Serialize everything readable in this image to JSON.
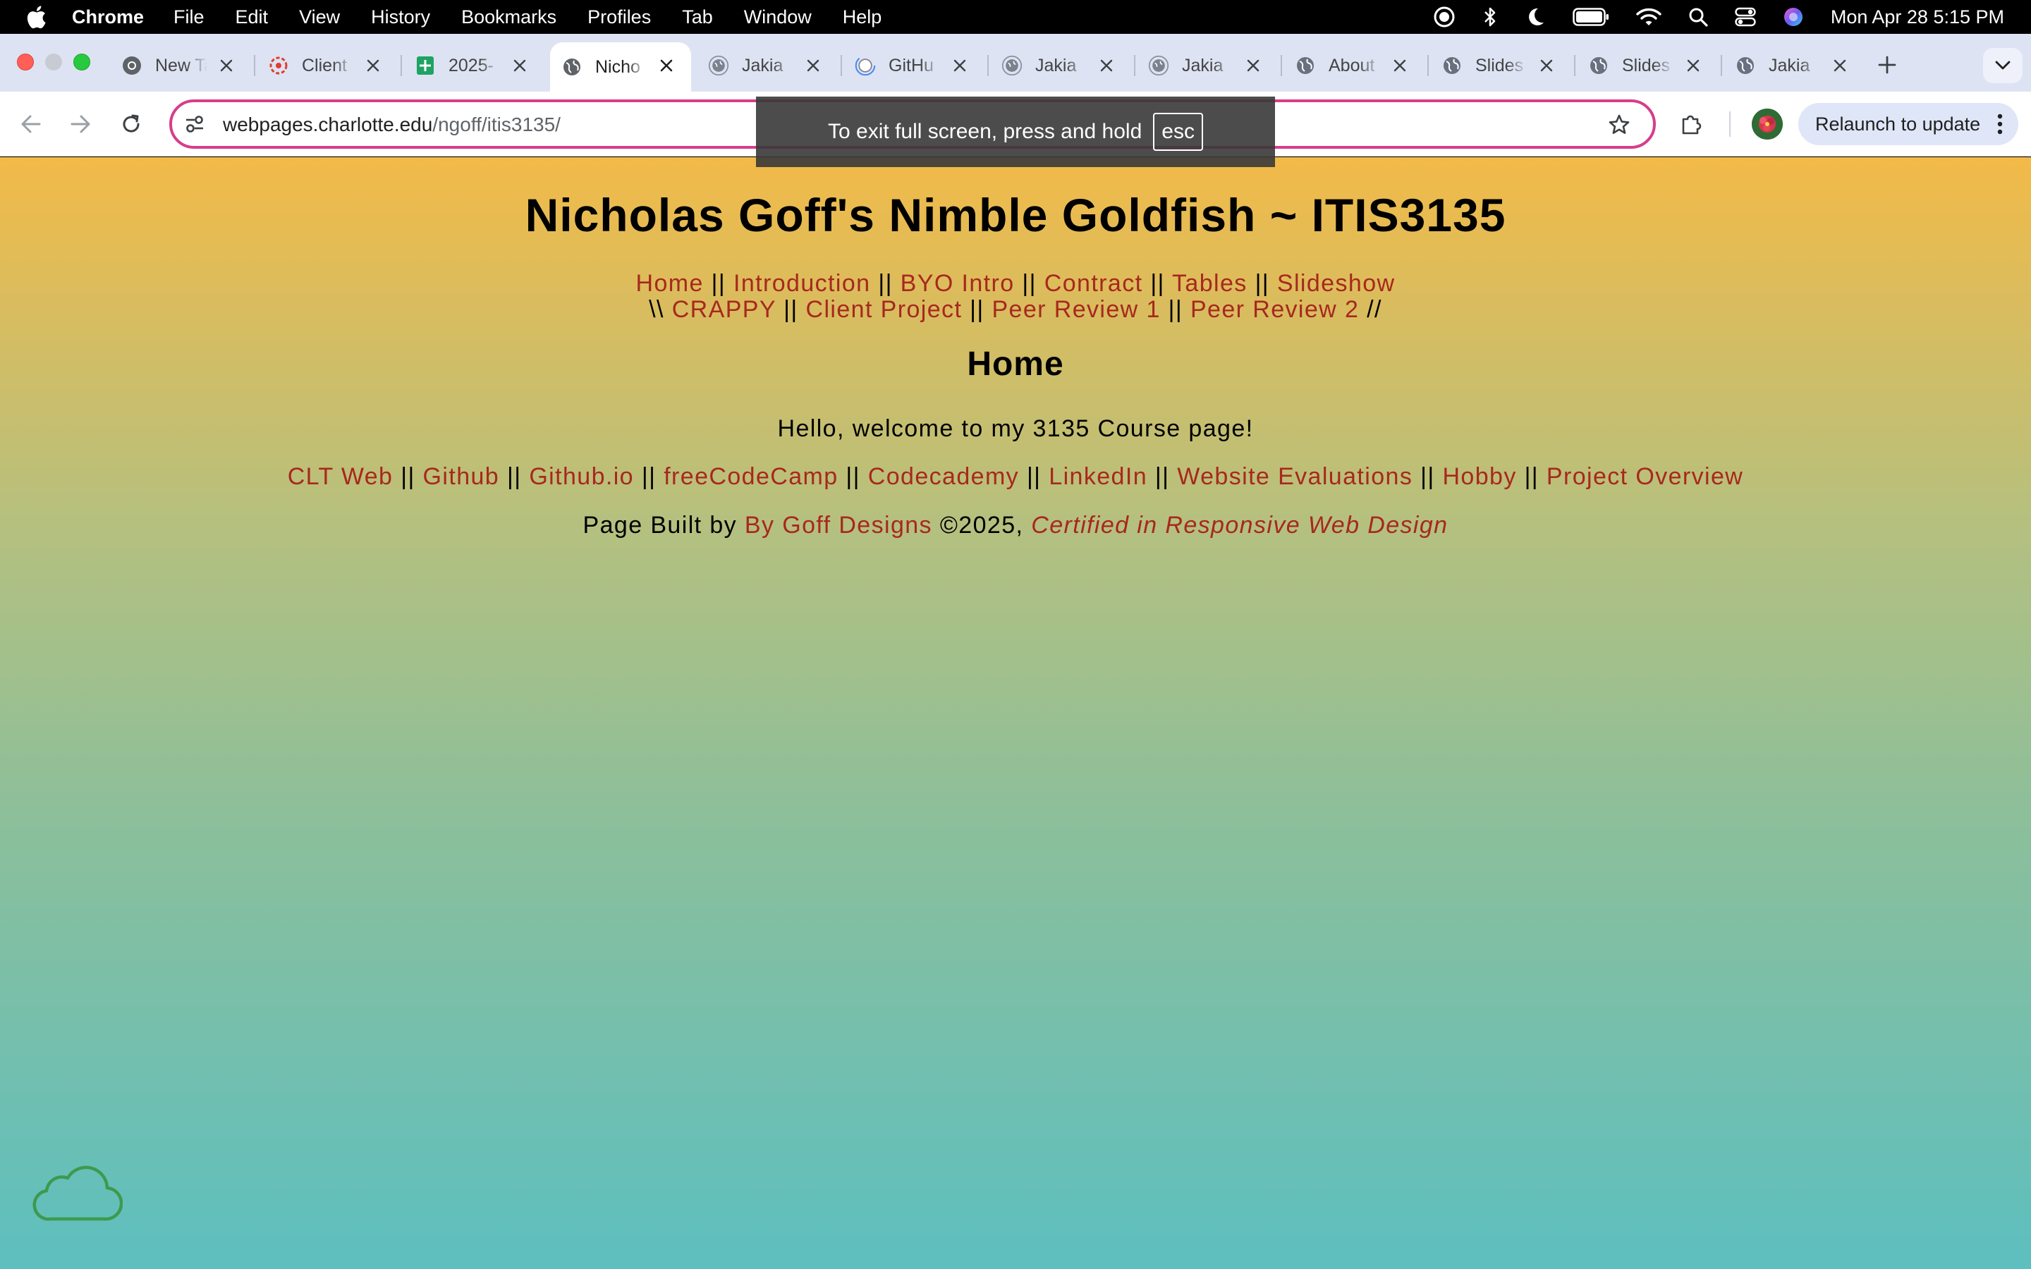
{
  "menubar": {
    "app_name": "Chrome",
    "menus": [
      "File",
      "Edit",
      "View",
      "History",
      "Bookmarks",
      "Profiles",
      "Tab",
      "Window",
      "Help"
    ],
    "status_icons": [
      "screen-record-icon",
      "bluetooth-icon",
      "focus-moon-icon",
      "battery-icon",
      "wifi-icon",
      "spotlight-search-icon",
      "control-center-icon",
      "siri-icon"
    ],
    "clock": "Mon Apr 28  5:15 PM"
  },
  "tabs": [
    {
      "title": "New Tab",
      "icon": "chrome-icon",
      "active": false
    },
    {
      "title": "Client",
      "icon": "canvas-icon",
      "active": false
    },
    {
      "title": "2025-",
      "icon": "sheets-icon",
      "active": false
    },
    {
      "title": "Nicho",
      "icon": "globe-icon",
      "active": true
    },
    {
      "title": "Jakia",
      "icon": "loading-globe-icon",
      "active": false
    },
    {
      "title": "GitHu",
      "icon": "loading-globe-icon",
      "active": false
    },
    {
      "title": "Jakia",
      "icon": "loading-globe-icon",
      "active": false
    },
    {
      "title": "Jakia",
      "icon": "loading-globe-icon",
      "active": false
    },
    {
      "title": "About",
      "icon": "globe-icon",
      "active": false
    },
    {
      "title": "Slides",
      "icon": "globe-icon",
      "active": false
    },
    {
      "title": "Slides",
      "icon": "globe-icon",
      "active": false
    },
    {
      "title": "Jakia",
      "icon": "globe-icon",
      "active": false
    }
  ],
  "toolbar": {
    "url_domain": "webpages.charlotte.edu",
    "url_path": "/ngoff/itis3135/",
    "relaunch_label": "Relaunch to update"
  },
  "fullscreen_toast": {
    "text": "To exit full screen, press and hold",
    "key": "esc"
  },
  "page": {
    "site_title": "Nicholas Goff's Nimble Goldfish ~ ITIS3135",
    "nav_row1": [
      "Home",
      "Introduction",
      "BYO Intro",
      "Contract",
      "Tables",
      "Slideshow"
    ],
    "nav_row2_prefix": "\\\\",
    "nav_row2": [
      "CRAPPY",
      "Client Project",
      "Peer Review 1",
      "Peer Review 2"
    ],
    "nav_row2_suffix": "//",
    "separator": "||",
    "heading": "Home",
    "welcome": "Hello, welcome to my 3135 Course page!",
    "external_links": [
      "CLT Web",
      "Github",
      "Github.io",
      "freeCodeCamp",
      "Codecademy",
      "LinkedIn",
      "Website Evaluations",
      "Hobby",
      "Project Overview"
    ],
    "footer_prefix": "Page Built by",
    "footer_brand": "By Goff Designs",
    "footer_year": "©2025,",
    "footer_cert": "Certified in Responsive Web Design"
  },
  "colors": {
    "link": "#a7281e",
    "gradient_top": "#f2ba48",
    "gradient_bottom": "#5dbfbf",
    "omnibox_border": "#d63e8a"
  }
}
